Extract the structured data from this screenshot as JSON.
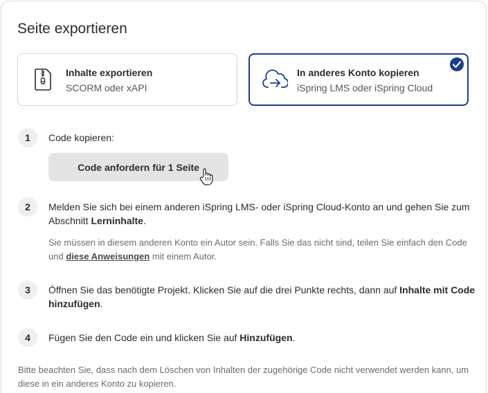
{
  "dialog": {
    "title": "Seite exportieren"
  },
  "options": {
    "export": {
      "title": "Inhalte exportieren",
      "subtitle": "SCORM oder xAPI",
      "icon": "zip-file-icon"
    },
    "copy": {
      "title": "In anderes Konto kopieren",
      "subtitle": "iSpring LMS oder iSpring Cloud",
      "icon": "cloud-transfer-icon",
      "selected": true
    }
  },
  "steps": [
    {
      "number": "1",
      "text": "Code kopieren:",
      "button_label": "Code anfordern für 1 Seite"
    },
    {
      "number": "2",
      "text_before": "Melden Sie sich bei einem anderen iSpring LMS- oder iSpring Cloud-Konto an und gehen Sie zum Abschnitt ",
      "text_bold": "Lerninhalte",
      "text_after": ".",
      "note_before": "Sie müssen in diesem anderen Konto ein Autor sein. Falls Sie das nicht sind, teilen Sie einfach den Code und ",
      "note_link": "diese Anweisungen",
      "note_after": " mit einem Autor."
    },
    {
      "number": "3",
      "text_before": "Öffnen Sie das benötigte Projekt. Klicken Sie auf die drei Punkte rechts, dann auf ",
      "text_bold": "Inhalte mit Code hinzufügen",
      "text_after": "."
    },
    {
      "number": "4",
      "text_before": "Fügen Sie den Code ein und klicken Sie auf ",
      "text_bold": "Hinzufügen",
      "text_after": "."
    }
  ],
  "footer": {
    "note": "Bitte beachten Sie, dass nach dem Löschen von Inhalten der zugehörige Code nicht verwendet werden kann, um diese in ein anderes Konto zu kopieren."
  },
  "colors": {
    "accent": "#1a3e8c",
    "button_bg": "#e4e4e4",
    "step_badge_bg": "#efefef"
  }
}
